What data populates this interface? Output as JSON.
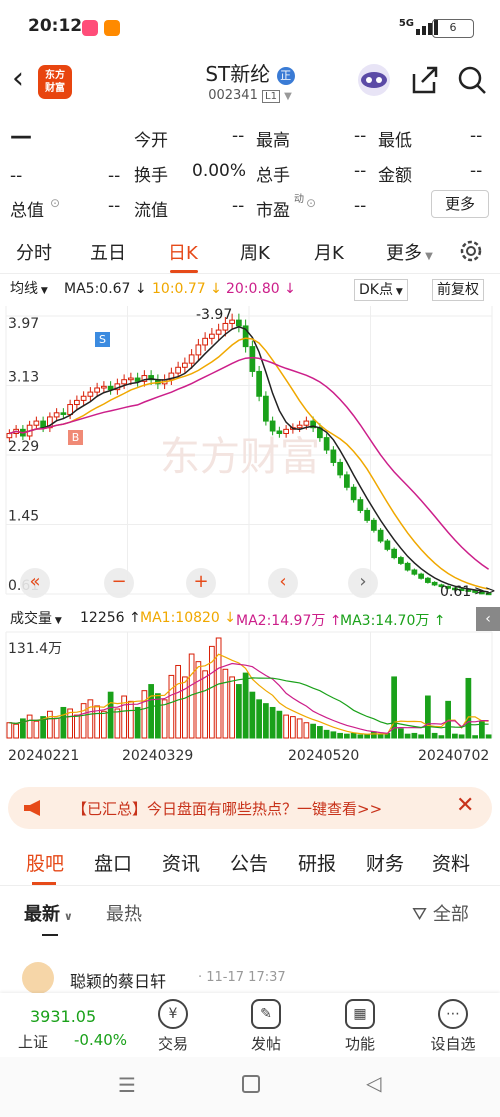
{
  "status_bar": {
    "time": "20:12",
    "network": "5G",
    "battery": "6"
  },
  "header": {
    "logo_text": "东方\n财富",
    "stock_name": "ST新纶",
    "stock_code": "002341",
    "level_badge": "L1",
    "tag_badge": "正"
  },
  "quote": {
    "price": "—",
    "change": "--",
    "change_pct": "--",
    "rows": [
      [
        {
          "label": "今开",
          "value": "--"
        },
        {
          "label": "最高",
          "value": "--"
        },
        {
          "label": "最低",
          "value": "--"
        }
      ],
      [
        {
          "label": "换手",
          "value": "0.00%"
        },
        {
          "label": "总手",
          "value": "--"
        },
        {
          "label": "金额",
          "value": "--"
        }
      ],
      [
        {
          "label": "总值",
          "value": "--"
        },
        {
          "label": "流值",
          "value": "--"
        },
        {
          "label": "市盈",
          "value": "--"
        }
      ]
    ],
    "pe_superscript": "动",
    "more_label": "更多"
  },
  "tabs": [
    "分时",
    "五日",
    "日K",
    "周K",
    "月K",
    "更多"
  ],
  "active_tab": "日K",
  "ma_bar": {
    "mode": "均线",
    "ma5": "MA5:0.67 ↓",
    "ma10": "10:0.77 ↓",
    "ma20": "20:0.80 ↓",
    "dk": "DK点",
    "adj": "前复权"
  },
  "colors": {
    "up": "#d81e06",
    "down": "#1aa11a",
    "ma5": "#222222",
    "ma10": "#f0a800",
    "ma20": "#cc1f8a",
    "accent": "#e64a19"
  },
  "chart_data": {
    "type": "candlestick",
    "price_axis_labels": [
      "3.97",
      "3.13",
      "2.29",
      "1.45",
      "0.61"
    ],
    "ylim": [
      0.61,
      3.97
    ],
    "max_label": "-3.97",
    "min_label": "0.61",
    "markers": [
      "S",
      "B"
    ],
    "watermark": "东方财富",
    "x_labels": [
      "20240221",
      "20240329",
      "20240520",
      "20240702"
    ],
    "closes": [
      2.55,
      2.6,
      2.52,
      2.65,
      2.7,
      2.62,
      2.75,
      2.8,
      2.78,
      2.9,
      2.95,
      3.0,
      3.05,
      3.1,
      3.12,
      3.08,
      3.15,
      3.2,
      3.22,
      3.18,
      3.25,
      3.2,
      3.15,
      3.2,
      3.28,
      3.35,
      3.4,
      3.5,
      3.62,
      3.7,
      3.75,
      3.8,
      3.88,
      3.92,
      3.85,
      3.6,
      3.3,
      3.0,
      2.7,
      2.58,
      2.55,
      2.6,
      2.62,
      2.65,
      2.7,
      2.62,
      2.5,
      2.35,
      2.2,
      2.05,
      1.9,
      1.75,
      1.62,
      1.5,
      1.38,
      1.25,
      1.15,
      1.05,
      0.98,
      0.9,
      0.85,
      0.8,
      0.75,
      0.72,
      0.7,
      0.68,
      0.67,
      0.66,
      0.65,
      0.63,
      0.62,
      0.61
    ],
    "volume_header": {
      "label": "成交量",
      "vol": "12256 ↑",
      "ma1": "MA1:10820 ↓",
      "ma2": "MA2:14.97万 ↑",
      "ma3": "MA3:14.70万 ↑"
    },
    "volume_axis_max": "131.4万",
    "volumes": [
      20,
      18,
      25,
      30,
      22,
      28,
      35,
      26,
      40,
      38,
      30,
      45,
      50,
      42,
      35,
      60,
      38,
      55,
      48,
      40,
      62,
      70,
      58,
      50,
      82,
      95,
      80,
      110,
      100,
      88,
      120,
      131,
      90,
      80,
      70,
      85,
      60,
      50,
      45,
      40,
      35,
      30,
      28,
      25,
      20,
      18,
      15,
      10,
      8,
      6,
      5,
      6,
      4,
      4,
      8,
      5,
      6,
      80,
      12,
      5,
      6,
      4,
      55,
      6,
      3,
      48,
      5,
      4,
      78,
      3,
      22,
      4
    ]
  },
  "banner": {
    "text": "【已汇总】今日盘面有哪些热点？一键查看>>"
  },
  "sub_tabs": [
    "股吧",
    "盘口",
    "资讯",
    "公告",
    "研报",
    "财务",
    "资料"
  ],
  "sort": {
    "latest": "最新",
    "hot": "最热",
    "filter": "全部"
  },
  "post": {
    "author": "聪颖的蔡日轩",
    "time": "· 11-17 17:37"
  },
  "bottom_bar": {
    "index_value": "3931.05",
    "index_name": "上证",
    "index_change": "-0.40%",
    "items": [
      "交易",
      "发帖",
      "功能",
      "设自选"
    ]
  }
}
